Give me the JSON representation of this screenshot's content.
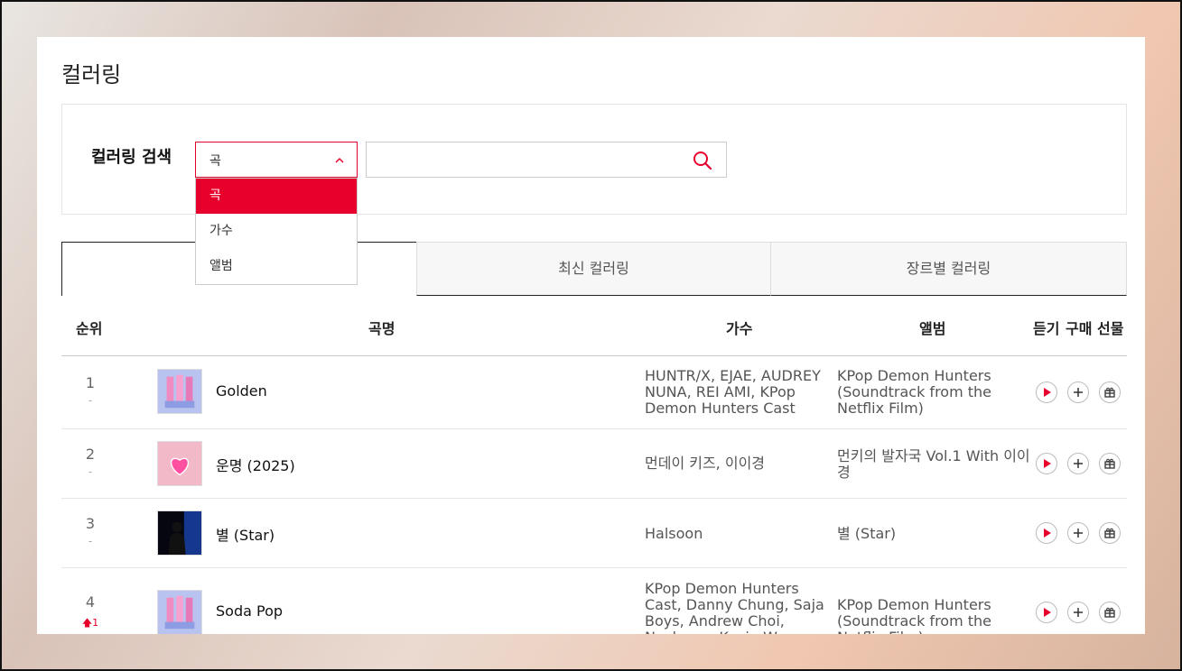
{
  "page": {
    "title": "컬러링"
  },
  "search": {
    "label": "컬러링 검색",
    "type_selected": "곡",
    "options": [
      "곡",
      "가수",
      "앨범"
    ],
    "query_value": "",
    "query_placeholder": ""
  },
  "tabs": [
    {
      "label": ""
    },
    {
      "label": "최신 컬러링"
    },
    {
      "label": "장르별 컬러링"
    }
  ],
  "table": {
    "headers": {
      "rank": "순위",
      "song": "곡명",
      "artist": "가수",
      "album": "앨범",
      "listen": "듣기",
      "buy": "구매",
      "gift": "선물"
    },
    "rows": [
      {
        "rank": "1",
        "change": "-",
        "title": "Golden",
        "artist": "HUNTR/X, EJAE, AUDREY NUNA, REI AMI, KPop Demon Hunters Cast",
        "album": "KPop Demon Hunters (Soundtrack from the Netflix Film)"
      },
      {
        "rank": "2",
        "change": "-",
        "title": "운명 (2025)",
        "artist": "먼데이 키즈, 이이경",
        "album": "먼키의 발자국 Vol.1 With 이이경"
      },
      {
        "rank": "3",
        "change": "-",
        "title": "별 (Star)",
        "artist": "Halsoon",
        "album": "별 (Star)"
      },
      {
        "rank": "4",
        "change": "1",
        "title": "Soda Pop",
        "artist": "KPop Demon Hunters Cast, Danny Chung, Saja Boys, Andrew Choi, Neckwav, Kevin Woo, samUIL Lee",
        "album": "KPop Demon Hunters (Soundtrack from the Netflix Film)"
      }
    ]
  },
  "colors": {
    "accent": "#e8002d",
    "border": "#dddddd"
  },
  "icons": {
    "search": "search-icon",
    "chevron": "chevron-up-icon",
    "play": "play-icon",
    "add": "plus-icon",
    "gift": "gift-icon",
    "rank_up": "arrow-up-icon"
  }
}
